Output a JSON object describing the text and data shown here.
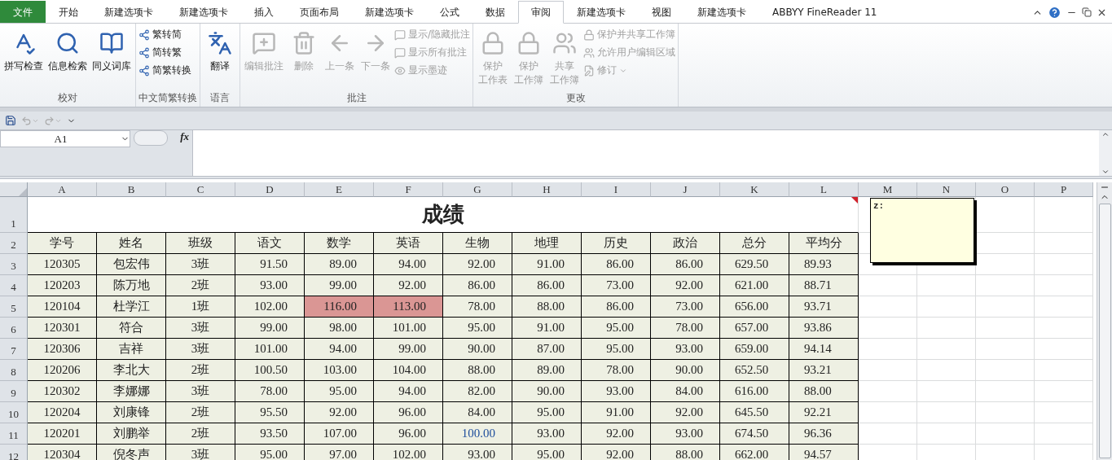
{
  "tabs": [
    {
      "label": "文件",
      "kind": "file",
      "selected": false
    },
    {
      "label": "开始",
      "kind": "tab",
      "selected": false
    },
    {
      "label": "新建选项卡",
      "kind": "tab",
      "selected": false
    },
    {
      "label": "新建选项卡",
      "kind": "tab",
      "selected": false
    },
    {
      "label": "插入",
      "kind": "tab",
      "selected": false
    },
    {
      "label": "页面布局",
      "kind": "tab",
      "selected": false
    },
    {
      "label": "新建选项卡",
      "kind": "tab",
      "selected": false
    },
    {
      "label": "公式",
      "kind": "tab",
      "selected": false
    },
    {
      "label": "数据",
      "kind": "tab",
      "selected": false
    },
    {
      "label": "审阅",
      "kind": "tab",
      "selected": true
    },
    {
      "label": "新建选项卡",
      "kind": "tab",
      "selected": false
    },
    {
      "label": "视图",
      "kind": "tab",
      "selected": false
    },
    {
      "label": "新建选项卡",
      "kind": "tab",
      "selected": false
    },
    {
      "label": "ABBYY FineReader 11",
      "kind": "tab",
      "selected": false
    }
  ],
  "ribbon": [
    {
      "label": "校对",
      "buttons": [
        {
          "lines": [
            "拼写检查"
          ],
          "kind": "large",
          "disabled": false
        },
        {
          "lines": [
            "信息检索"
          ],
          "kind": "large",
          "disabled": false
        },
        {
          "lines": [
            "同义词库"
          ],
          "kind": "large",
          "disabled": false
        }
      ]
    },
    {
      "label": "中文简繁转换",
      "buttons": [
        {
          "lines": [
            "繁转简"
          ],
          "kind": "small",
          "disabled": false
        },
        {
          "lines": [
            "简转繁"
          ],
          "kind": "small",
          "disabled": false
        },
        {
          "lines": [
            "简繁转换"
          ],
          "kind": "small",
          "disabled": false
        }
      ]
    },
    {
      "label": "语言",
      "buttons": [
        {
          "lines": [
            "翻译"
          ],
          "kind": "large",
          "disabled": false
        }
      ]
    },
    {
      "label": "批注",
      "buttons": [
        {
          "lines": [
            "编辑批注"
          ],
          "kind": "large",
          "disabled": true
        },
        {
          "lines": [
            "删除"
          ],
          "kind": "large",
          "disabled": true
        },
        {
          "lines": [
            "上一条"
          ],
          "kind": "large",
          "disabled": true
        },
        {
          "lines": [
            "下一条"
          ],
          "kind": "large",
          "disabled": true
        },
        {
          "lines": [
            "显示/隐藏批注"
          ],
          "kind": "small",
          "disabled": true
        },
        {
          "lines": [
            "显示所有批注"
          ],
          "kind": "small",
          "disabled": true
        },
        {
          "lines": [
            "显示墨迹"
          ],
          "kind": "small",
          "disabled": true
        }
      ]
    },
    {
      "label": "更改",
      "buttons": [
        {
          "lines": [
            "保护",
            "工作表"
          ],
          "kind": "large",
          "disabled": true
        },
        {
          "lines": [
            "保护",
            "工作簿"
          ],
          "kind": "large",
          "disabled": true
        },
        {
          "lines": [
            "共享",
            "工作簿"
          ],
          "kind": "large",
          "disabled": true
        },
        {
          "lines": [
            "保护并共享工作簿"
          ],
          "kind": "small",
          "disabled": true
        },
        {
          "lines": [
            "允许用户编辑区域"
          ],
          "kind": "small",
          "disabled": true
        },
        {
          "lines": [
            "修订"
          ],
          "kind": "small",
          "disabled": true,
          "dropdown": true
        }
      ]
    }
  ],
  "name_box": {
    "value": "A1"
  },
  "formula_bar": {
    "fx": "fx"
  },
  "row_numbers": [
    "1",
    "2",
    "3",
    "4",
    "5",
    "6",
    "7",
    "8",
    "9",
    "10",
    "11",
    "12"
  ],
  "columns": [
    "A",
    "B",
    "C",
    "D",
    "E",
    "F",
    "G",
    "H",
    "I",
    "J",
    "K",
    "L",
    "M",
    "N",
    "O",
    "P"
  ],
  "sheet_title": "成绩",
  "header_row": [
    "学号",
    "姓名",
    "班级",
    "语文",
    "数学",
    "英语",
    "生物",
    "地理",
    "历史",
    "政治",
    "总分",
    "平均分"
  ],
  "rows": [
    {
      "cells": [
        "120305",
        "包宏伟",
        "3班",
        "91.50",
        "89.00",
        "94.00",
        "92.00",
        "91.00",
        "86.00",
        "86.00",
        "629.50",
        "89.93"
      ]
    },
    {
      "cells": [
        "120203",
        "陈万地",
        "2班",
        "93.00",
        "99.00",
        "92.00",
        "86.00",
        "86.00",
        "73.00",
        "92.00",
        "621.00",
        "88.71"
      ]
    },
    {
      "cells": [
        "120104",
        "杜学江",
        "1班",
        "102.00",
        {
          "text": "116.00",
          "highlighted": true
        },
        {
          "text": "113.00",
          "highlighted": true
        },
        "78.00",
        "88.00",
        "86.00",
        "73.00",
        "656.00",
        "93.71"
      ]
    },
    {
      "cells": [
        "120301",
        "符合",
        "3班",
        "99.00",
        "98.00",
        "101.00",
        "95.00",
        "91.00",
        "95.00",
        "78.00",
        "657.00",
        "93.86"
      ]
    },
    {
      "cells": [
        "120306",
        "吉祥",
        "3班",
        "101.00",
        "94.00",
        "99.00",
        "90.00",
        "87.00",
        "95.00",
        "93.00",
        "659.00",
        "94.14"
      ]
    },
    {
      "cells": [
        "120206",
        "李北大",
        "2班",
        "100.50",
        "103.00",
        "104.00",
        "88.00",
        "89.00",
        "78.00",
        "90.00",
        "652.50",
        "93.21"
      ]
    },
    {
      "cells": [
        "120302",
        "李娜娜",
        "3班",
        "78.00",
        "95.00",
        "94.00",
        "82.00",
        "90.00",
        "93.00",
        "84.00",
        "616.00",
        "88.00"
      ]
    },
    {
      "cells": [
        "120204",
        "刘康锋",
        "2班",
        "95.50",
        "92.00",
        "96.00",
        "84.00",
        "95.00",
        "91.00",
        "92.00",
        "645.50",
        "92.21"
      ]
    },
    {
      "cells": [
        "120201",
        "刘鹏举",
        "2班",
        "93.50",
        "107.00",
        "96.00",
        {
          "text": "100.00",
          "color": "#1f4e9c"
        },
        "93.00",
        "92.00",
        "93.00",
        "674.50",
        "96.36"
      ]
    },
    {
      "cells": [
        "120304",
        "倪冬声",
        "3班",
        "95.00",
        "97.00",
        "102.00",
        "93.00",
        "95.00",
        "92.00",
        "88.00",
        "662.00",
        "94.57"
      ]
    }
  ],
  "comment": {
    "text": "z:"
  }
}
